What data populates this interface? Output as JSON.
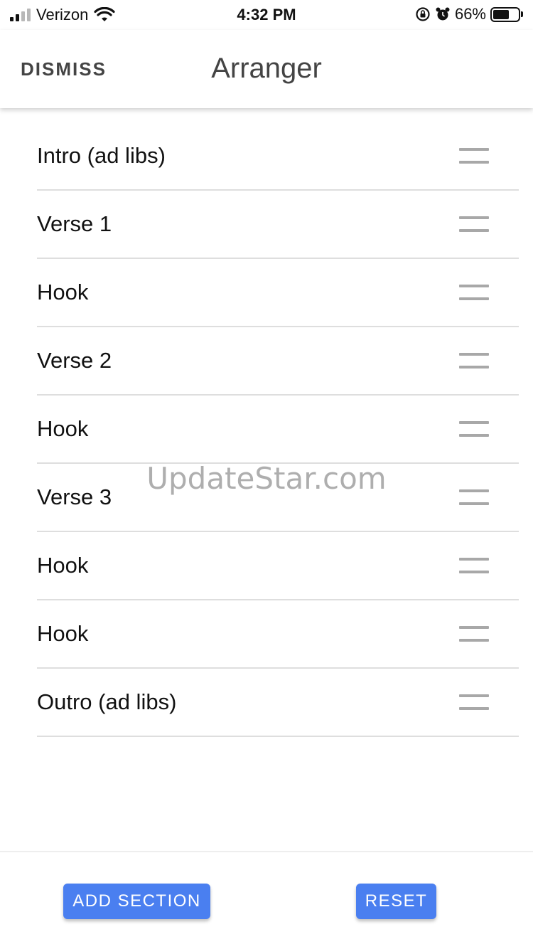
{
  "status_bar": {
    "carrier": "Verizon",
    "time": "4:32 PM",
    "battery": "66%"
  },
  "header": {
    "dismiss_label": "DISMISS",
    "title": "Arranger"
  },
  "sections": [
    {
      "label": "Intro (ad libs)"
    },
    {
      "label": "Verse 1"
    },
    {
      "label": "Hook"
    },
    {
      "label": "Verse 2"
    },
    {
      "label": "Hook"
    },
    {
      "label": "Verse 3"
    },
    {
      "label": "Hook"
    },
    {
      "label": "Hook"
    },
    {
      "label": "Outro (ad libs)"
    }
  ],
  "watermark": "UpdateStar.com",
  "footer": {
    "add_label": "ADD SECTION",
    "reset_label": "RESET"
  },
  "colors": {
    "accent": "#4a7ff0",
    "divider": "#dedede",
    "handle": "#a8a8a8"
  },
  "icons": {
    "signal": "cellular-signal-icon",
    "wifi": "wifi-icon",
    "rotation_lock": "rotation-lock-icon",
    "alarm": "alarm-icon",
    "battery": "battery-icon",
    "drag": "drag-handle-icon"
  }
}
